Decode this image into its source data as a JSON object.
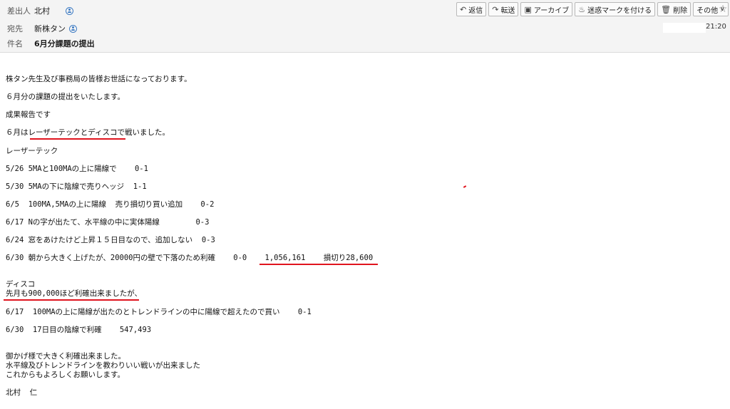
{
  "header": {
    "from_label": "差出人",
    "from_value": "北村",
    "to_label": "宛先",
    "to_value": "新株タン",
    "subject_label": "件名",
    "subject_value": "6月分課題の提出",
    "time": "21:20"
  },
  "toolbar": {
    "reply": "返信",
    "forward": "転送",
    "archive": "アーカイブ",
    "junk": "迷惑マークを付ける",
    "delete": "削除",
    "more": "その他"
  },
  "body": {
    "l1": "株タン先生及び事務局の皆様お世話になっております。",
    "l2": "６月分の課題の提出をいたします。",
    "l3": "成果報告です",
    "l4": "６月はレーザーテックとディスコで戦いました。",
    "l5": "レーザーテック",
    "l6": "5/26 5MAと100MAの上に陽線で    0-1",
    "l7": "5/30 5MAの下に陰線で売りヘッジ  1-1",
    "l8": "6/5  100MA,5MAの上に陽線  売り損切り買い追加    0-2",
    "l9": "6/17 Nの字が出たて、水平線の中に実体陽線        0-3",
    "l10": "6/24 窓をあけたけど上昇１５日目なので、追加しない  0-3",
    "l11": "6/30 朝から大きく上げたが、20000円の壁で下落のため利確    0-0    1,056,161    損切り28,600",
    "l12": "ディスコ",
    "l13": "先月も900,000ほど利確出来ましたが、",
    "l14": "6/17  100MAの上に陽線が出たのとトレンドラインの中に陽線で超えたので買い    0-1",
    "l15": "6/30  17日目の陰線で利確    547,493",
    "l16": "御かげ様で大きく利確出来ました。",
    "l17": "水平線及びトレンドラインを教わりいい戦いが出来ました",
    "l18": "これからもよろしくお願いします。",
    "l19": "北村  仁"
  }
}
